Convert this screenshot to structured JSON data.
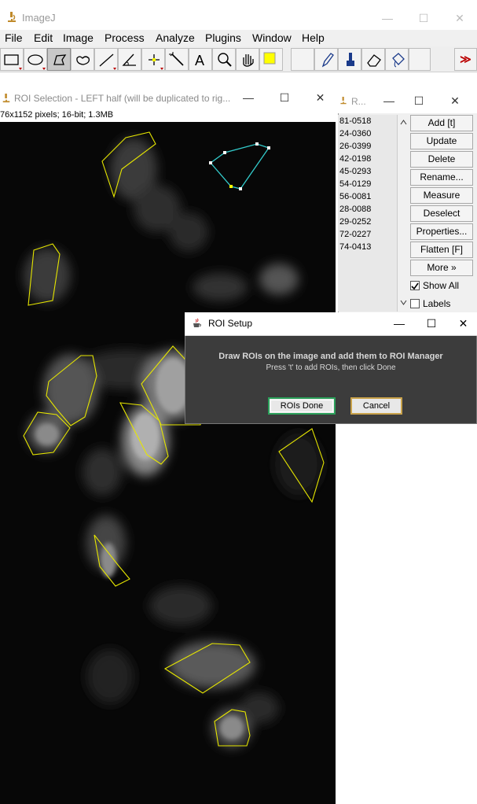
{
  "main_window": {
    "title": "ImageJ",
    "controls": {
      "minimize": "—",
      "maximize": "☐",
      "close": "✕"
    }
  },
  "menubar": [
    "File",
    "Edit",
    "Image",
    "Process",
    "Analyze",
    "Plugins",
    "Window",
    "Help"
  ],
  "toolbar": {
    "tools": [
      "rectangle-tool",
      "oval-tool",
      "polygon-tool",
      "freehand-tool",
      "line-tool",
      "angle-tool",
      "point-tool",
      "wand-tool",
      "text-tool",
      "magnifier-tool",
      "hand-tool",
      "color-picker",
      "empty-slot",
      "pencil-tool",
      "brush-tool",
      "eraser-tool",
      "flood-fill-tool",
      "empty-slot",
      "more-tools"
    ],
    "selected_tool": "polygon-tool",
    "foreground_color": "#ffff00",
    "more_label": "≫"
  },
  "image_window": {
    "title": "ROI Selection - LEFT half (will be duplicated to rig...",
    "info": "76x1152 pixels; 16-bit; 1.3MB",
    "controls": {
      "minimize": "—",
      "maximize": "☐",
      "close": "✕"
    },
    "roi_color": "#e6e600",
    "active_roi_color": "#33cccc"
  },
  "roi_manager": {
    "title": "R...",
    "controls": {
      "minimize": "—",
      "maximize": "☐",
      "close": "✕"
    },
    "items": [
      "81-0518",
      "24-0360",
      "26-0399",
      "42-0198",
      "45-0293",
      "54-0129",
      "56-0081",
      "28-0088",
      "29-0252",
      "72-0227",
      "74-0413"
    ],
    "buttons": [
      "Add [t]",
      "Update",
      "Delete",
      "Rename...",
      "Measure",
      "Deselect",
      "Properties...",
      "Flatten [F]",
      "More »"
    ],
    "show_all_label": "Show All",
    "show_all_checked": true,
    "labels_label": "Labels",
    "labels_checked": false
  },
  "dialog": {
    "title": "ROI Setup",
    "controls": {
      "minimize": "—",
      "maximize": "☐",
      "close": "✕"
    },
    "message": "Draw ROIs on the image and add them to ROI Manager",
    "submessage": "Press 't' to add ROIs, then click Done",
    "ok_label": "ROIs Done",
    "cancel_label": "Cancel"
  }
}
